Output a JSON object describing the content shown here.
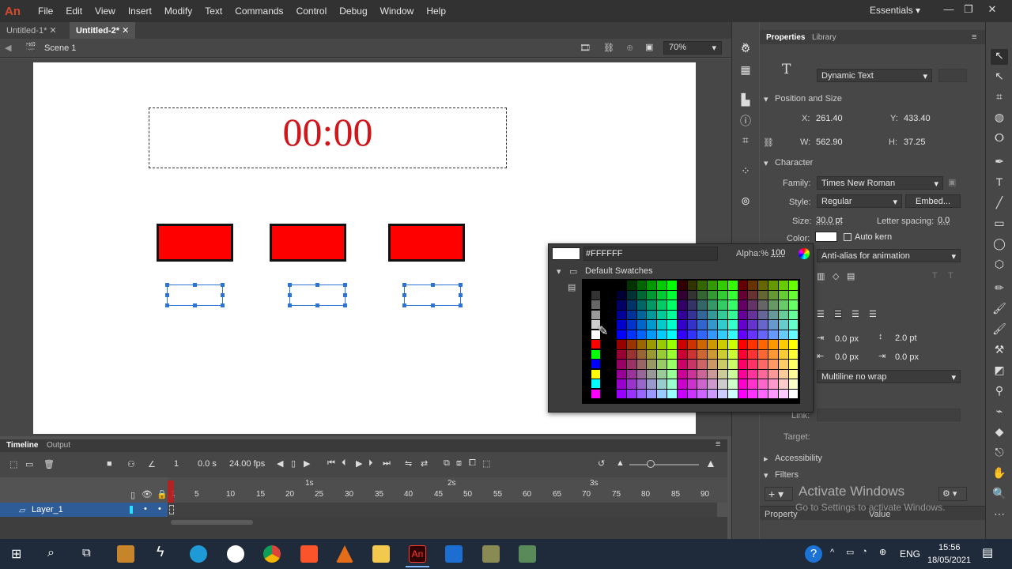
{
  "app": {
    "logo": "An"
  },
  "menu": [
    "File",
    "Edit",
    "View",
    "Insert",
    "Modify",
    "Text",
    "Commands",
    "Control",
    "Debug",
    "Window",
    "Help"
  ],
  "workspace": {
    "label": "Essentials"
  },
  "doc_tabs": [
    "Untitled-1*",
    "Untitled-2*"
  ],
  "edit_bar": {
    "scene": "Scene 1",
    "zoom": "70%"
  },
  "stage": {
    "timer_text": "00:00"
  },
  "timeline": {
    "tabs": [
      "Timeline",
      "Output"
    ],
    "frame": "1",
    "time": "0.0 s",
    "fps": "24.00 fps",
    "seconds": [
      "1s",
      "2s",
      "3s"
    ],
    "ticks": [
      "1",
      "5",
      "10",
      "15",
      "20",
      "25",
      "30",
      "35",
      "40",
      "45",
      "50",
      "55",
      "60",
      "65",
      "70",
      "75",
      "80",
      "85",
      "90"
    ],
    "layer_name": "Layer_1"
  },
  "properties": {
    "tabs": [
      "Properties",
      "Library"
    ],
    "text_type": "Dynamic Text",
    "pos_size_title": "Position and Size",
    "x_label": "X:",
    "x": "261.40",
    "y_label": "Y:",
    "y": "433.40",
    "w_label": "W:",
    "w": "562.90",
    "h_label": "H:",
    "h": "37.25",
    "character_title": "Character",
    "family_label": "Family:",
    "family": "Times New Roman",
    "style_label": "Style:",
    "style": "Regular",
    "embed": "Embed...",
    "size_label": "Size:",
    "size": "30.0 pt",
    "letter_spacing_label": "Letter spacing:",
    "letter_spacing": "0.0",
    "color_label": "Color:",
    "auto_kern": "Auto kern",
    "anti_alias": "Anti-alias for animation",
    "indent1": "0.0 px",
    "line_spacing": "2.0 pt",
    "indent2": "0.0 px",
    "indent3": "0.0 px",
    "line_type": "Multiline no wrap",
    "link_label": "Link:",
    "target_label": "Target:",
    "accessibility": "Accessibility",
    "filters": "Filters",
    "filter_col_property": "Property",
    "filter_col_value": "Value"
  },
  "color_popup": {
    "hex": "#FFFFFF",
    "alpha_label": "Alpha:%",
    "alpha": "100",
    "swatches_label": "Default Swatches"
  },
  "watermark": {
    "line1": "Activate Windows",
    "line2": "Go to Settings to activate Windows."
  },
  "taskbar": {
    "lang": "ENG",
    "time": "15:56",
    "date": "18/05/2021"
  }
}
